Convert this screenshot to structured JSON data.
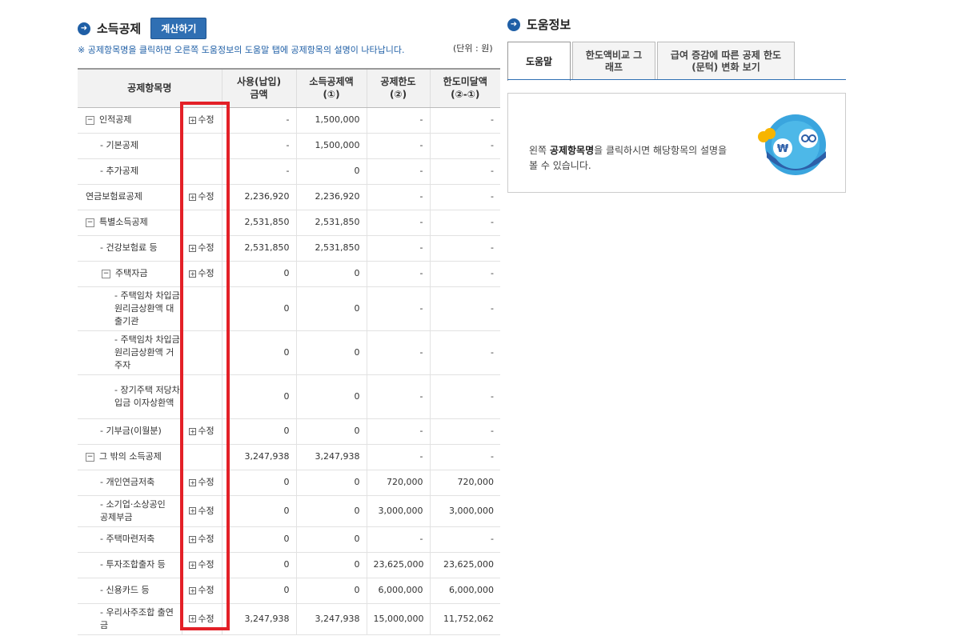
{
  "left_section": {
    "title": "소득공제",
    "calc_button": "계산하기",
    "note": "※ 공제항목명을 클릭하면 오른쪽 도움정보의 도움말 탭에 공제항목의 설명이 나타납니다.",
    "unit": "(단위 : 원)"
  },
  "table": {
    "headers": {
      "name": "공제항목명",
      "paid_1": "사용(납입)",
      "paid_2": "금액",
      "deduct_1": "소득공제액",
      "deduct_2": "(①)",
      "limit_1": "공제한도",
      "limit_2": "(②)",
      "remain_1": "한도미달액",
      "remain_2": "(②-①)"
    },
    "edit_label": "수정",
    "rows": [
      {
        "name": "인적공제",
        "paid": "-",
        "deduct": "1,500,000",
        "limit": "-",
        "remain": "-"
      },
      {
        "name": "- 기본공제",
        "paid": "-",
        "deduct": "1,500,000",
        "limit": "-",
        "remain": "-"
      },
      {
        "name": "- 추가공제",
        "paid": "-",
        "deduct": "0",
        "limit": "-",
        "remain": "-"
      },
      {
        "name": "연금보험료공제",
        "paid": "2,236,920",
        "deduct": "2,236,920",
        "limit": "-",
        "remain": "-"
      },
      {
        "name": "특별소득공제",
        "paid": "2,531,850",
        "deduct": "2,531,850",
        "limit": "-",
        "remain": "-"
      },
      {
        "name": "- 건강보험료 등",
        "paid": "2,531,850",
        "deduct": "2,531,850",
        "limit": "-",
        "remain": "-"
      },
      {
        "name": "주택자금",
        "paid": "0",
        "deduct": "0",
        "limit": "-",
        "remain": "-"
      },
      {
        "name": "- 주택임차 차입금 원리금상환액 대출기관",
        "paid": "0",
        "deduct": "0",
        "limit": "-",
        "remain": "-"
      },
      {
        "name": "- 주택임차 차입금 원리금상환액 거주자",
        "paid": "0",
        "deduct": "0",
        "limit": "-",
        "remain": "-"
      },
      {
        "name": "- 장기주택 저당차입금 이자상환액",
        "paid": "0",
        "deduct": "0",
        "limit": "-",
        "remain": "-"
      },
      {
        "name": "- 기부금(이월분)",
        "paid": "0",
        "deduct": "0",
        "limit": "-",
        "remain": "-"
      },
      {
        "name": "그 밖의 소득공제",
        "paid": "3,247,938",
        "deduct": "3,247,938",
        "limit": "-",
        "remain": "-"
      },
      {
        "name": "- 개인연금저축",
        "paid": "0",
        "deduct": "0",
        "limit": "720,000",
        "remain": "720,000"
      },
      {
        "name": "- 소기업·소상공인 공제부금",
        "paid": "0",
        "deduct": "0",
        "limit": "3,000,000",
        "remain": "3,000,000"
      },
      {
        "name": "- 주택마련저축",
        "paid": "0",
        "deduct": "0",
        "limit": "-",
        "remain": "-"
      },
      {
        "name": "- 투자조합출자 등",
        "paid": "0",
        "deduct": "0",
        "limit": "23,625,000",
        "remain": "23,625,000"
      },
      {
        "name": "- 신용카드 등",
        "paid": "0",
        "deduct": "0",
        "limit": "6,000,000",
        "remain": "6,000,000"
      },
      {
        "name": "- 우리사주조합 출연금",
        "paid": "3,247,938",
        "deduct": "3,247,938",
        "limit": "15,000,000",
        "remain": "11,752,062"
      }
    ]
  },
  "right_section": {
    "title": "도움정보",
    "tabs": [
      "도움말",
      "한도액비교 그래프",
      "급여 증감에 따른 공제 한도(문턱) 변화 보기"
    ],
    "help_text_prefix": "왼쪽 ",
    "help_text_bold": "공제항목명",
    "help_text_suffix": "을 클릭하시면 해당항목의 설명을 볼 수 있습니다."
  },
  "icons": {
    "section_bullet": "circle-arrow-icon",
    "toggle_expanded": "minus-box-icon",
    "edit": "plus-box-icon",
    "mascot": "won-mascot-icon"
  },
  "colors": {
    "accent": "#2f6fb3",
    "highlight_box": "#e32027"
  }
}
